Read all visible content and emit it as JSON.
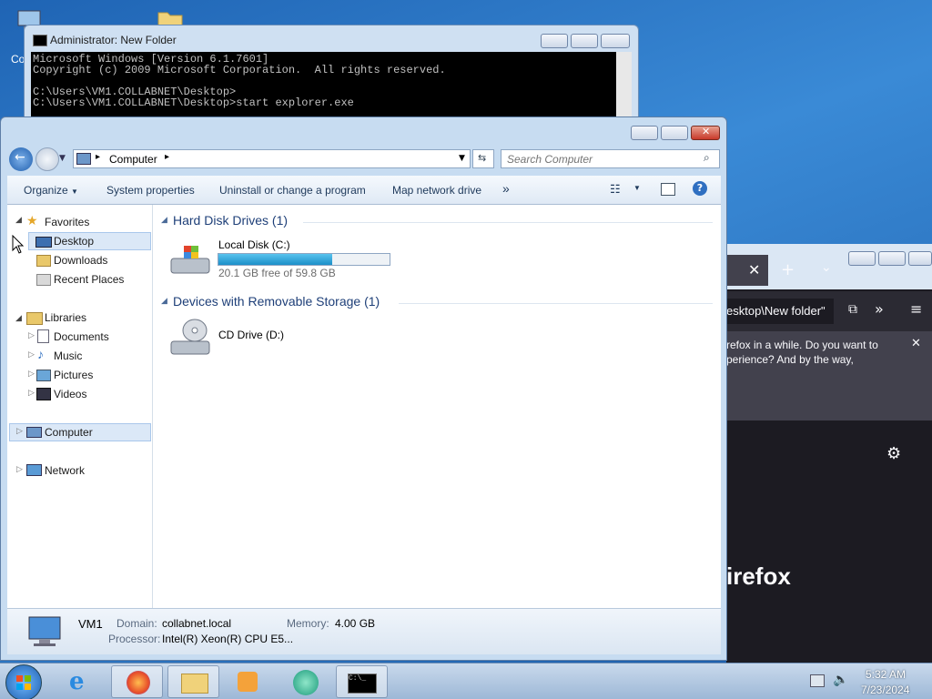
{
  "desktop": {
    "partial_icon_label": "Co"
  },
  "cmd": {
    "title": "Administrator: New Folder",
    "lines": [
      "Microsoft Windows [Version 6.1.7601]",
      "Copyright (c) 2009 Microsoft Corporation.  All rights reserved.",
      "",
      "C:\\Users\\VM1.COLLABNET\\Desktop>",
      "C:\\Users\\VM1.COLLABNET\\Desktop>start explorer.exe"
    ]
  },
  "firefox": {
    "path_text": "esktop\\New folder\"",
    "notification_line1": "refox in a while. Do you want to",
    "notification_line2": "perience? And by the way,",
    "brand_text": "irefox"
  },
  "explorer": {
    "address": {
      "crumb": "Computer"
    },
    "search": {
      "placeholder": "Search Computer"
    },
    "toolbar": {
      "organize": "Organize",
      "system_properties": "System properties",
      "uninstall": "Uninstall or change a program",
      "map_drive": "Map network drive",
      "more": "»"
    },
    "nav": {
      "favorites": "Favorites",
      "desktop": "Desktop",
      "downloads": "Downloads",
      "recent": "Recent Places",
      "libraries": "Libraries",
      "documents": "Documents",
      "music": "Music",
      "pictures": "Pictures",
      "videos": "Videos",
      "computer": "Computer",
      "network": "Network"
    },
    "groups": {
      "hdd": "Hard Disk Drives (1)",
      "removable": "Devices with Removable Storage (1)"
    },
    "local_disk": {
      "name": "Local Disk (C:)",
      "free": "20.1 GB free of 59.8 GB",
      "used_fraction": 0.664
    },
    "cd_drive": {
      "name": "CD Drive (D:)"
    },
    "details": {
      "name": "VM1",
      "domain_label": "Domain:",
      "domain_value": "collabnet.local",
      "memory_label": "Memory:",
      "memory_value": "4.00 GB",
      "processor_label": "Processor:",
      "processor_value": "Intel(R) Xeon(R) CPU E5..."
    }
  },
  "taskbar": {
    "time": "5:32 AM",
    "date": "7/23/2024"
  },
  "colors": {
    "accent": "#1e3f78",
    "progress": "#26a0da",
    "close_red": "#c8392a"
  }
}
